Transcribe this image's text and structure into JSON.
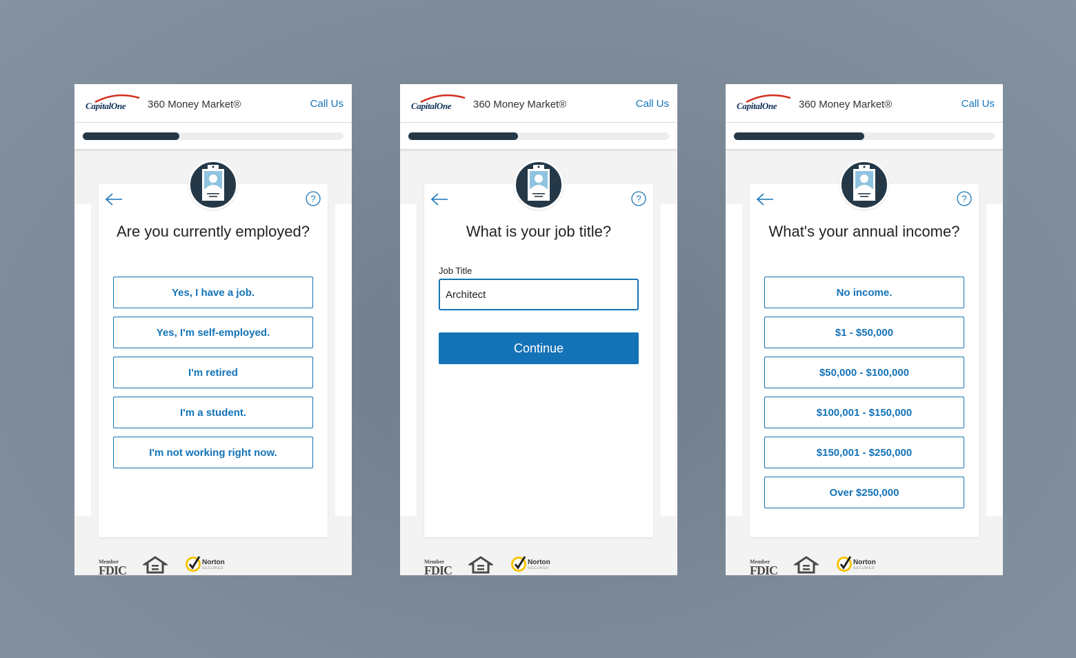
{
  "brand": {
    "logo_text": "CapitalOne",
    "product": "360 Money Market®",
    "call_us": "Call Us",
    "brand_blue": "#1473b7",
    "brand_navy": "#253847"
  },
  "screens": [
    {
      "progress_fraction": 0.37,
      "question": "Are you currently employed?",
      "options": [
        "Yes, I have a job.",
        "Yes, I'm self-employed.",
        "I'm retired",
        "I'm a student.",
        "I'm not working right now."
      ]
    },
    {
      "progress_fraction": 0.42,
      "question": "What is your job title?",
      "field_label": "Job Title",
      "field_value": "Architect",
      "continue_label": "Continue"
    },
    {
      "progress_fraction": 0.5,
      "question": "What's your annual income?",
      "options": [
        "No income.",
        "$1 - $50,000",
        "$50,000 - $100,000",
        "$100,001 - $150,000",
        "$150,001 - $250,000",
        "Over $250,000"
      ]
    }
  ],
  "footer": {
    "fdic_member": "Member",
    "fdic": "FDIC",
    "norton": "Norton",
    "norton_sub": "SECURED"
  },
  "icons": {
    "back": "arrow-left-icon",
    "help": "question-circle-icon",
    "avatar": "id-badge-icon",
    "housing": "equal-housing-icon",
    "norton": "norton-check-icon"
  }
}
